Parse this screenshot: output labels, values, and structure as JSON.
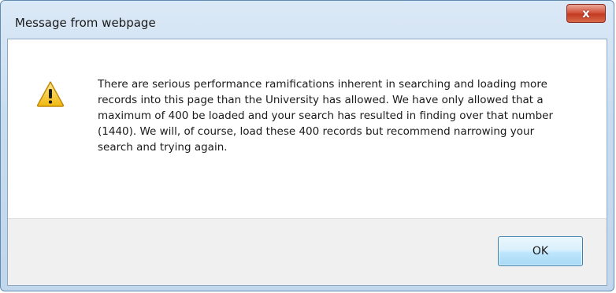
{
  "window": {
    "title": "Message from webpage",
    "close_label": "x"
  },
  "message": {
    "icon": "warning-icon",
    "text": "There are serious performance ramifications inherent in searching and loading more records into this page than the University has allowed. We have only allowed that a maximum of 400 be loaded and your search has resulted in finding over that number (1440).  We will, of course, load these 400 records but recommend narrowing your search and trying again."
  },
  "buttons": {
    "ok_label": "OK"
  },
  "colors": {
    "title_bar": "#c9dcef",
    "close_button": "#c23b21",
    "ok_button_border": "#3c7fb1",
    "warning_yellow": "#f5c21b"
  }
}
